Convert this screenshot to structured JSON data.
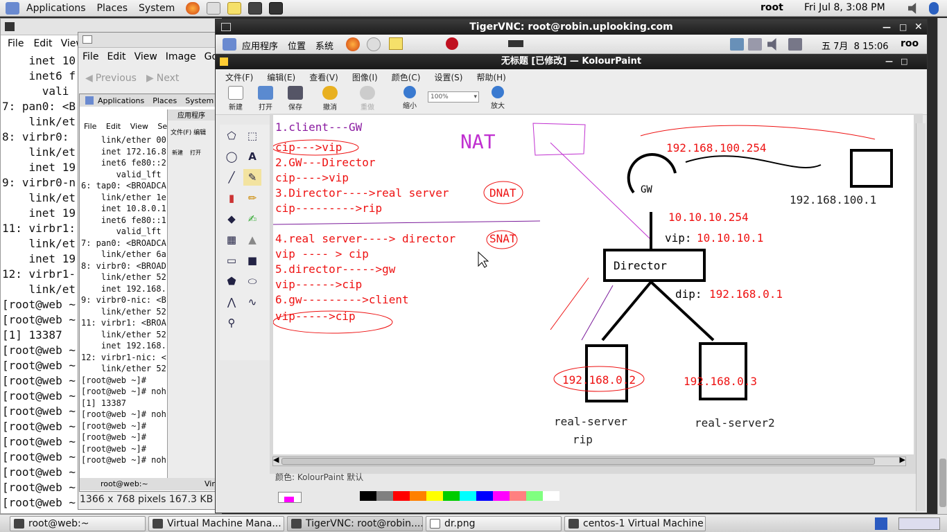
{
  "top_panel": {
    "menus": [
      "Applications",
      "Places",
      "System"
    ],
    "user": "root",
    "clock": "Fri Jul  8,  3:08 PM"
  },
  "bg_terminal": {
    "menus": [
      "File",
      "Edit",
      "View"
    ],
    "lines": [
      "    inet 10",
      "    inet6 f",
      "      vali",
      "7: pan0: <B",
      "    link/et",
      "8: virbr0:",
      "    link/et",
      "    inet 19",
      "9: virbr0-n",
      "    link/et",
      "    inet 19",
      "11: virbr1:",
      "    link/et",
      "    inet 19",
      "12: virbr1-",
      "    link/et",
      "[root@web ~",
      "[root@web ~",
      "[1] 13387",
      "[root@web ~",
      "",
      "[root@web ~",
      "[root@web ~",
      "[root@web ~",
      "[root@web ~",
      "[root@web ~",
      "[root@web ~",
      "[root@web ~",
      "[root@web ~",
      "[root@web ~",
      "[root@web ~"
    ]
  },
  "eog": {
    "menus": [
      "File",
      "Edit",
      "View",
      "Image",
      "Go"
    ],
    "prev": "Previous",
    "next": "Next",
    "info": "1366 x 768 pixels  167.3 KB"
  },
  "mini": {
    "panel": [
      "Applications",
      "Places",
      "System"
    ],
    "menus": [
      "File",
      "Edit",
      "View",
      "Search"
    ],
    "lines": [
      "    link/ether 00",
      "    inet 172.16.8",
      "    inet6 fe80::2",
      "       valid_lft",
      "6: tap0: <BROADCA",
      "    link/ether 1e",
      "    inet 10.8.0.1",
      "    inet6 fe80::1",
      "       valid_lft",
      "7: pan0: <BROADCA",
      "    link/ether 6a",
      "8: virbr0: <BROAD",
      "    link/ether 52",
      "    inet 192.168.",
      "9: virbr0-nic: <B",
      "    link/ether 52",
      "11: virbr1: <BROA",
      "    link/ether 52",
      "    inet 192.168.",
      "12: virbr1-nic: <",
      "    link/ether 52",
      "[root@web ~]#",
      "[root@web ~]# noh",
      "[1] 13387",
      "[root@web ~]# noh",
      "",
      "[root@web ~]#",
      "[root@web ~]#",
      "[root@web ~]#",
      "[root@web ~]# noh"
    ],
    "task": "root@web:~",
    "task2": "Vir",
    "panel2": "应用程序",
    "menus2": [
      "文件(F)",
      "编辑"
    ],
    "tools": [
      "新建",
      "打开"
    ]
  },
  "vnc": {
    "title": "TigerVNC: root@robin.uplooking.com",
    "remote_panel": {
      "menus": [
        "应用程序",
        "位置",
        "系统"
      ],
      "clock": "五 7月  8 15:06",
      "user": "roo"
    },
    "kp_title": "无标题 [已修改] — KolourPaint",
    "kp_menu": [
      "文件(F)",
      "编辑(E)",
      "查看(V)",
      "图像(I)",
      "颜色(C)",
      "设置(S)",
      "帮助(H)"
    ],
    "toolbar": {
      "new": "新建",
      "open": "打开",
      "save": "保存",
      "undo": "撤消",
      "redo": "重做",
      "zoom_out": "缩小",
      "zoom": "100%",
      "zoom_in": "放大"
    },
    "status": "颜色: KolourPaint 默认"
  },
  "drawing": {
    "left": [
      "1.client---GW",
      "cip--->vip",
      "2.GW---Director",
      "cip---->vip",
      "3.Director---->real server",
      "cip--------->rip",
      "4.real server----> director",
      "vip ---- > cip",
      "5.director----->gw",
      "vip------>cip",
      "6.gw--------->client",
      "vip----->cip"
    ],
    "dnat": "DNAT",
    "snat": "SNAT",
    "nat": "NAT",
    "gw": "GW",
    "gw_ip_top": "192.168.100.254",
    "gw_ip_bottom": "10.10.10.254",
    "client_ip": "192.168.100.1",
    "vip": "vip:",
    "vip_val": "10.10.10.1",
    "director": "Director",
    "dip": "dip:",
    "dip_val": "192.168.0.1",
    "rs1_ip": "192.168.0.2",
    "rs2_ip": "192.168.0.3",
    "rs1_name": "real-server",
    "rs1_rip": "rip",
    "rs2_name": "real-server2"
  },
  "palette": [
    "#000000",
    "#808080",
    "#ff0000",
    "#ff8000",
    "#ffff00",
    "#00cc00",
    "#00ffff",
    "#0000ff",
    "#ff00ff",
    "#ff8080",
    "#80ff80",
    "#ffffff"
  ],
  "taskbar": [
    "root@web:~",
    "Virtual Machine Mana...",
    "TigerVNC: root@robin....",
    "dr.png",
    "centos-1 Virtual Machine"
  ]
}
